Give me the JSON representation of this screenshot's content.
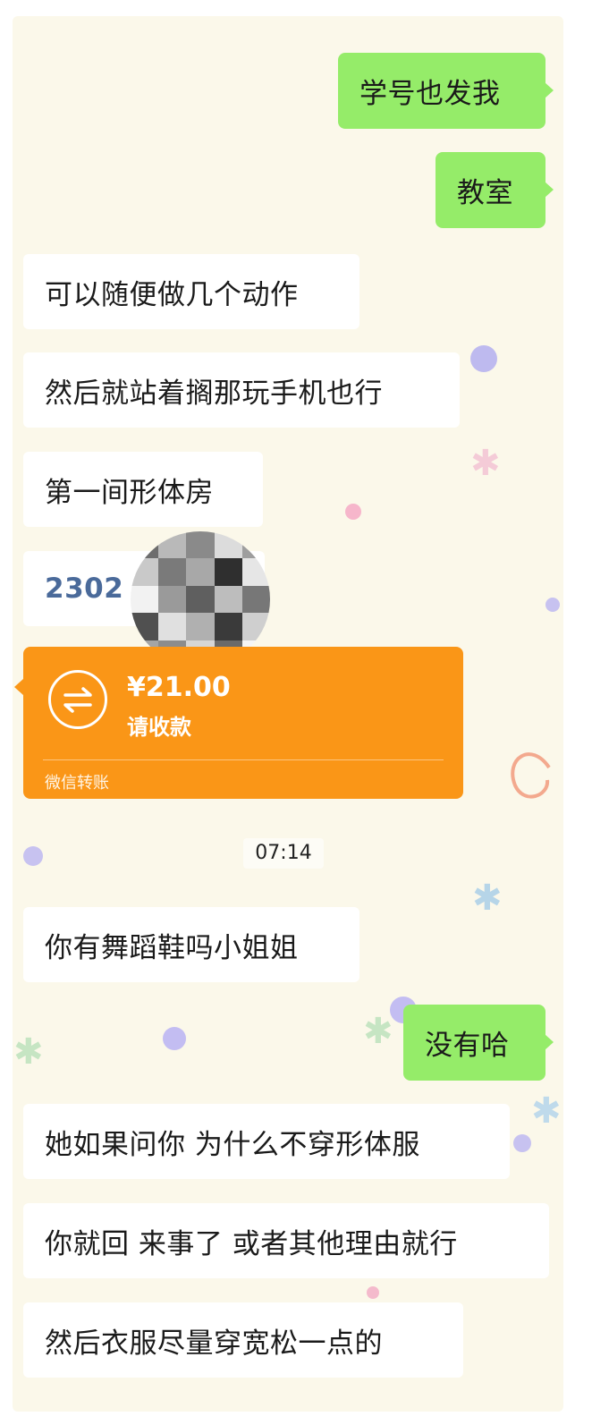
{
  "theme": {
    "chat_background": "#fbf8ea",
    "sent_bubble": "#95ec69",
    "received_bubble": "#ffffff",
    "transfer_card": "#fa9617"
  },
  "messages": [
    {
      "side": "right",
      "text": "学号也发我"
    },
    {
      "side": "right",
      "text": "教室"
    },
    {
      "side": "left",
      "text": "可以随便做几个动作"
    },
    {
      "side": "left",
      "text": "然后就站着搁那玩手机也行"
    },
    {
      "side": "left",
      "text": "第一间形体房"
    },
    {
      "side": "left",
      "text": "2302"
    },
    {
      "side": "left",
      "text": "你有舞蹈鞋吗小姐姐"
    },
    {
      "side": "right",
      "text": "没有哈"
    },
    {
      "side": "left",
      "text": "她如果问你 为什么不穿形体服"
    },
    {
      "side": "left",
      "text": "你就回 来事了 或者其他理由就行"
    },
    {
      "side": "left",
      "text": "然后衣服尽量穿宽松一点的"
    }
  ],
  "transfer": {
    "amount": "¥21.00",
    "status": "请收款",
    "label": "微信转账",
    "icon": "transfer-arrows-icon"
  },
  "timestamp": "07:14",
  "overlay": {
    "icon": "mosaic-blur-overlay"
  }
}
